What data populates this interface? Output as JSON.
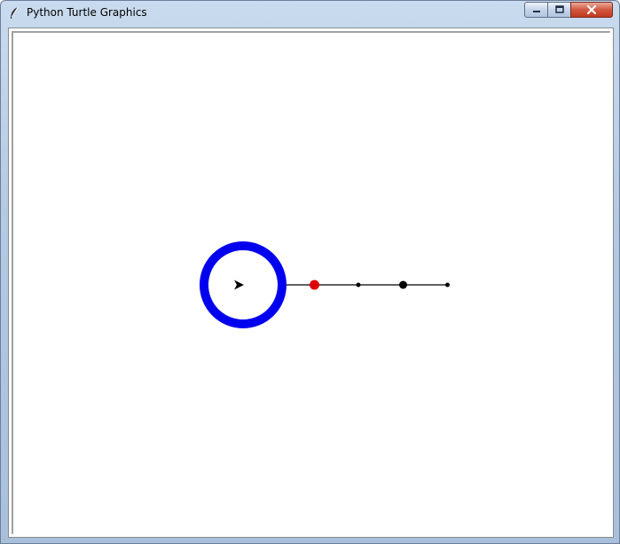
{
  "window": {
    "title": "Python Turtle Graphics",
    "icon": "feather-icon",
    "controls": {
      "minimize_icon": "minimize-icon",
      "maximize_icon": "maximize-icon",
      "close_icon": "close-icon"
    }
  },
  "canvas": {
    "background": "#ffffff",
    "circle_color": "#0000ee",
    "line_color": "#000000",
    "turtle_color": "#000000",
    "dot_colors": [
      "#dd0000",
      "#000000",
      "#000000",
      "#000000"
    ],
    "turtle_heading": "east",
    "turtle_icon": "arrow-turtle-icon"
  }
}
